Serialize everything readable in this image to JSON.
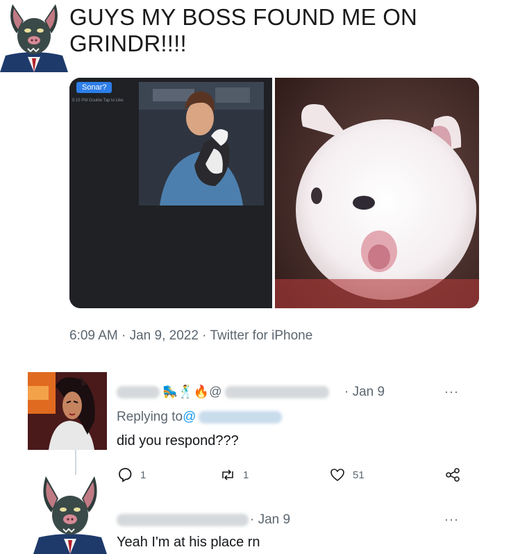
{
  "main_tweet": {
    "text": "GUYS MY BOSS FOUND ME ON GRINDR!!!!",
    "meta": "6:09 AM · Jan 9, 2022 · Twitter for iPhone",
    "media": {
      "sonar_label": "Sonar?",
      "sonar_meta": "5:15 PM  Double Tap to Like"
    }
  },
  "reply_1": {
    "name_emojis": "🛼🕺🔥@",
    "date": "· Jan 9",
    "replying_prefix": "Replying to ",
    "replying_handle": "@",
    "body": "did you respond???",
    "actions": {
      "reply_count": "1",
      "retweet_count": "1",
      "like_count": "51"
    },
    "more": "···"
  },
  "reply_2": {
    "date": "· Jan 9",
    "body": "Yeah I'm at his place rn",
    "more": "···"
  },
  "colors": {
    "accent": "#1d9bf0",
    "muted": "#5b6670"
  },
  "icons": [
    "reply-icon",
    "retweet-icon",
    "like-icon",
    "share-icon",
    "more-icon"
  ]
}
